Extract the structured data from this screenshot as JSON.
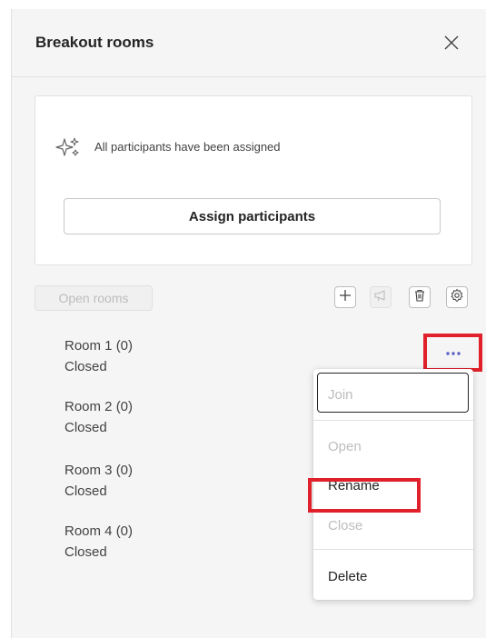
{
  "panel": {
    "title": "Breakout rooms",
    "close_icon": "close-icon"
  },
  "assignment": {
    "status_text": "All participants have been assigned",
    "status_icon": "sparkle-icon",
    "assign_button": "Assign participants"
  },
  "toolbar": {
    "open_rooms": "Open rooms",
    "icons": [
      "add-icon",
      "announcement-icon",
      "delete-icon",
      "settings-icon"
    ]
  },
  "rooms": [
    {
      "name": "Room 1  (0)",
      "status": "Closed"
    },
    {
      "name": "Room 2  (0)",
      "status": "Closed"
    },
    {
      "name": "Room 3  (0)",
      "status": "Closed"
    },
    {
      "name": "Room 4  (0)",
      "status": "Closed"
    }
  ],
  "more_options_icon": "more-horizontal-icon",
  "context_menu": {
    "join": "Join",
    "open": "Open",
    "rename": "Rename",
    "close": "Close",
    "delete": "Delete"
  },
  "colors": {
    "accent": "#5b5fc7",
    "highlight": "#e0202a",
    "disabled_text": "#bdbdbd"
  }
}
